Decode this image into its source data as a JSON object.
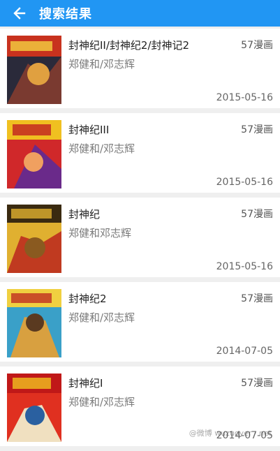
{
  "header": {
    "title": "搜索结果",
    "back_icon": "arrow-left-icon",
    "color": "#2196f3"
  },
  "results": [
    {
      "name": "封神纪II/封神纪2/封神记2",
      "author": "郑健和/邓志辉",
      "source": "57漫画",
      "date": "2015-05-16",
      "cover_colors": [
        "#c8321e",
        "#2a2a3a",
        "#e0a040"
      ]
    },
    {
      "name": "封神纪III",
      "author": "郑健和/邓志辉",
      "source": "57漫画",
      "date": "2015-05-16",
      "cover_colors": [
        "#d0282a",
        "#f0c020",
        "#6a2a8a"
      ]
    },
    {
      "name": "封神纪",
      "author": "郑健和邓志辉",
      "source": "57漫画",
      "date": "2015-05-16",
      "cover_colors": [
        "#e0b030",
        "#3a2a10",
        "#c03a20"
      ]
    },
    {
      "name": "封神纪2",
      "author": "郑健和/邓志辉",
      "source": "57漫画",
      "date": "2014-07-05",
      "cover_colors": [
        "#3aa0c8",
        "#d8a040",
        "#5a3a20"
      ]
    },
    {
      "name": "封神纪I",
      "author": "郑健和/邓志辉",
      "source": "57漫画",
      "date": "2014-07-05",
      "cover_colors": [
        "#e03020",
        "#f0e0c0",
        "#2a60a0"
      ]
    }
  ],
  "watermark": "@微博 wuzuoyer · net"
}
